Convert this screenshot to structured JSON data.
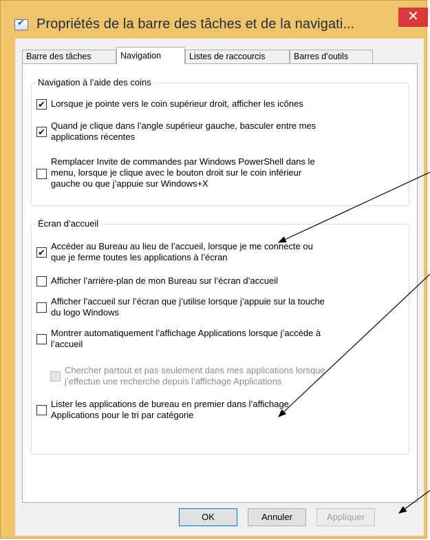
{
  "window": {
    "title": "Propriétés de la barre des tâches et de la navigati...",
    "close_glyph": "✕"
  },
  "tabs": [
    {
      "label": "Barre des tâches"
    },
    {
      "label": "Navigation",
      "active": true
    },
    {
      "label": "Listes de raccourcis"
    },
    {
      "label": "Barres d’outils"
    }
  ],
  "corners": {
    "title": "Navigation à l’aide des coins",
    "options": [
      {
        "lines": [
          "Lorsque je pointe vers le coin supérieur droit, afficher les icônes"
        ],
        "checked": true
      },
      {
        "lines": [
          "Quand je clique dans l’angle supérieur gauche, basculer entre mes",
          "applications récentes"
        ],
        "checked": true
      },
      {
        "lines": [
          "Remplacer Invite de commandes par Windows PowerShell dans le",
          "menu, lorsque je clique avec le bouton droit sur le coin inférieur",
          "gauche ou que j’appuie sur Windows+X"
        ],
        "checked": false
      }
    ]
  },
  "start": {
    "title": "Écran d’accueil",
    "options": [
      {
        "lines": [
          "Accéder au Bureau au lieu de l’accueil, lorsque je me connecte ou",
          "que je ferme toutes les applications à l’écran"
        ],
        "checked": true
      },
      {
        "lines": [
          "Afficher l’arrière-plan de mon Bureau sur l’écran d’accueil"
        ],
        "checked": false
      },
      {
        "lines": [
          "Afficher l’accueil sur l’écran que j’utilise lorsque j’appuie sur la touche",
          "du logo Windows"
        ],
        "checked": false
      },
      {
        "lines": [
          "Montrer automatiquement l’affichage Applications lorsque j’accède à",
          "l’accueil"
        ],
        "checked": false
      },
      {
        "lines": [
          "Chercher partout et pas seulement dans mes applications lorsque",
          "j’effectue une recherche depuis l’affichage Applications"
        ],
        "checked": false,
        "disabled": true
      },
      {
        "lines": [
          "Lister les applications de bureau en premier dans l’affichage",
          "Applications pour le tri par catégorie"
        ],
        "checked": false
      }
    ]
  },
  "buttons": {
    "ok": "OK",
    "cancel": "Annuler",
    "apply": "Appliquer"
  },
  "check_glyph": "✔"
}
